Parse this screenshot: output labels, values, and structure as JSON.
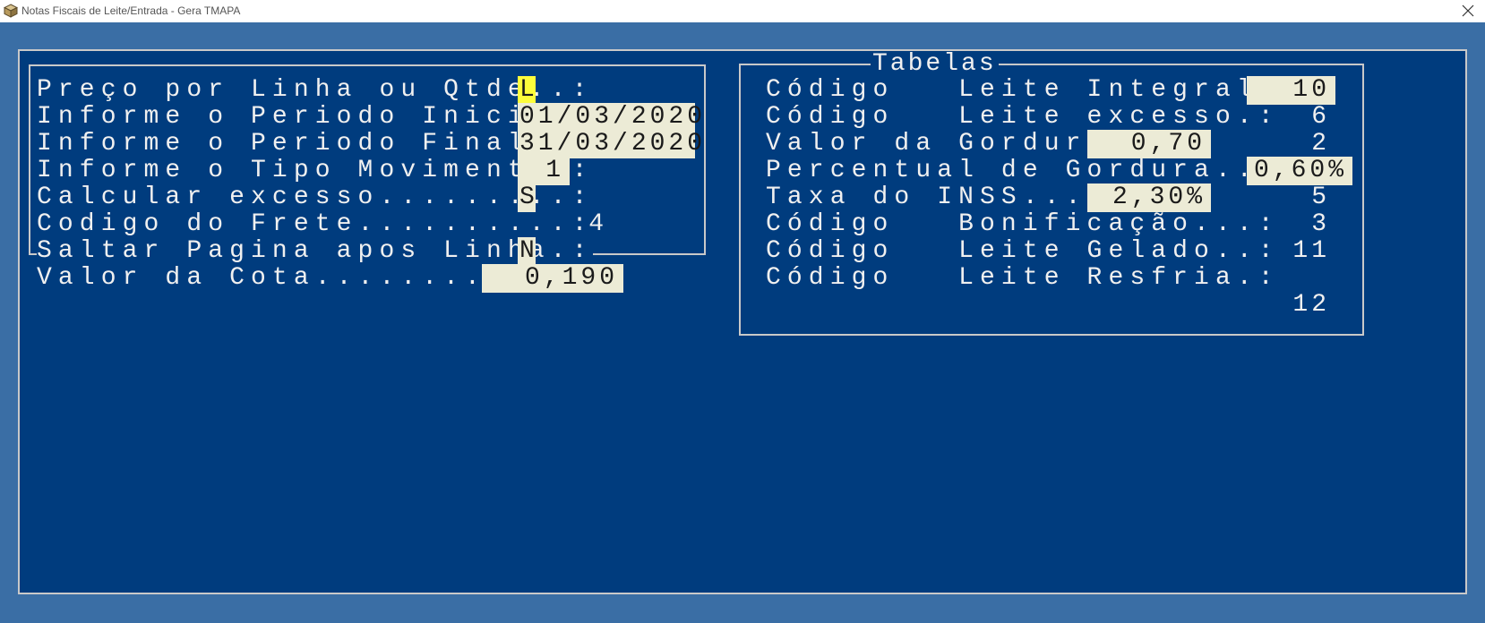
{
  "window": {
    "title": "Notas Fiscais de Leite/Entrada - Gera TMAPA",
    "icon": "package-icon",
    "close_icon": "close-icon"
  },
  "colors": {
    "background": "#3a6ea5",
    "console": "#003c7e",
    "field": "#ecebd6",
    "active_field": "#fdfd3b",
    "text": "#f0f0f0",
    "border": "#c9c9c9"
  },
  "left_form": {
    "rows": [
      {
        "label": "Preço por Linha ou Qtde..:",
        "value": "L"
      },
      {
        "label": "Informe o Periodo Inicial:",
        "value": "01/03/2020"
      },
      {
        "label": "Informe o Periodo Final..:",
        "value": "31/03/2020"
      },
      {
        "label": "Informe o Tipo Movimento.:",
        "value": "1"
      },
      {
        "label": "Calcular excesso.........:",
        "value": "S"
      },
      {
        "label": "Codigo do Frete..........:",
        "value": "4"
      },
      {
        "label": "Saltar Pagina apos Linha.:",
        "value": "N"
      },
      {
        "label": "Valor da Cota.........:",
        "value": "0,190"
      }
    ]
  },
  "tabelas": {
    "title": "Tabelas",
    "rows": [
      {
        "label": "Código   Leite Integral:",
        "field": "10"
      },
      {
        "label": "Código   Leite excesso.:",
        "value": "6"
      },
      {
        "label": "Valor da Gordura..",
        "field": "0,70",
        "value": "2"
      },
      {
        "label": "Percentual de Gordura..:",
        "field": "0,60%"
      },
      {
        "label": "Taxa do INSS......",
        "field": "2,30%",
        "value": "5"
      },
      {
        "label": "Código   Bonificação...:",
        "value": "3"
      },
      {
        "label": "Código   Leite Gelado..:",
        "value": "11"
      },
      {
        "label": "Código   Leite Resfria.:",
        "value": "12"
      }
    ]
  }
}
